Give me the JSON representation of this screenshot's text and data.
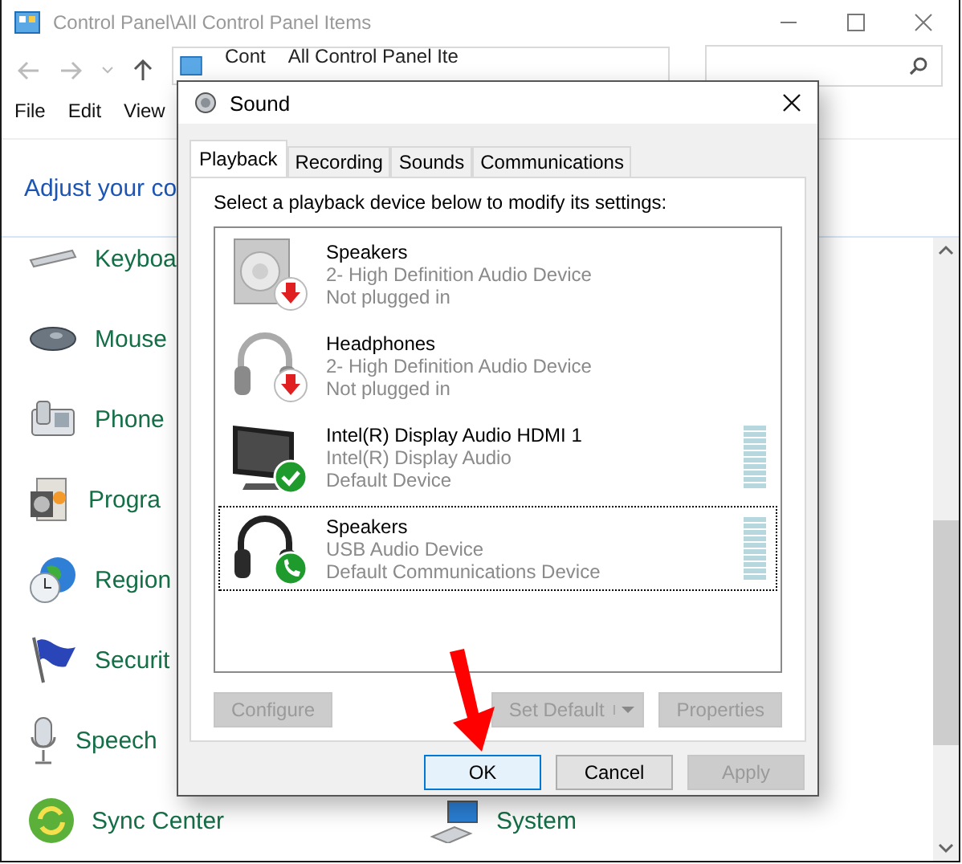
{
  "window": {
    "title": "Control Panel\\All Control Panel Items",
    "address": [
      "Cont",
      "All Control Panel Ite"
    ],
    "menu": [
      "File",
      "Edit",
      "View"
    ],
    "heading": "Adjust your co",
    "items": [
      {
        "kind": "keyboard",
        "label": "Keyboa"
      },
      {
        "kind": "mouse",
        "label": "Mouse"
      },
      {
        "kind": "phone",
        "label": "Phone"
      },
      {
        "kind": "programs",
        "label": "Progra"
      },
      {
        "kind": "region",
        "label": "Region"
      },
      {
        "kind": "security",
        "label": "Securit"
      },
      {
        "kind": "speech",
        "label": "Speech"
      },
      {
        "kind": "sync",
        "label": "Sync Center"
      },
      {
        "kind": "system",
        "label": "System"
      }
    ]
  },
  "dialog": {
    "title": "Sound",
    "tabs": [
      {
        "label": "Playback",
        "selected": true
      },
      {
        "label": "Recording",
        "selected": false
      },
      {
        "label": "Sounds",
        "selected": false
      },
      {
        "label": "Communications",
        "selected": false
      }
    ],
    "instruction": "Select a playback device below to modify its settings:",
    "devices": [
      {
        "kind": "speaker",
        "plugged_in": false,
        "default": false,
        "default_communications": false,
        "name": "Speakers",
        "detail": "2- High Definition Audio Device",
        "state": "Not plugged in",
        "selected": false,
        "meter": false
      },
      {
        "kind": "headphones",
        "plugged_in": false,
        "default": false,
        "default_communications": false,
        "name": "Headphones",
        "detail": "2- High Definition Audio Device",
        "state": "Not plugged in",
        "selected": false,
        "meter": false
      },
      {
        "kind": "monitor",
        "plugged_in": true,
        "default": true,
        "default_communications": false,
        "name": "Intel(R) Display Audio HDMI 1",
        "detail": "Intel(R) Display Audio",
        "state": "Default Device",
        "selected": false,
        "meter": true
      },
      {
        "kind": "headset",
        "plugged_in": true,
        "default": false,
        "default_communications": true,
        "name": "Speakers",
        "detail": "USB Audio Device",
        "state": "Default Communications Device",
        "selected": true,
        "meter": true
      }
    ],
    "panel_buttons": [
      {
        "label": "Configure",
        "disabled": true,
        "dropdown": false
      },
      {
        "label": "Set Default",
        "disabled": true,
        "dropdown": true
      },
      {
        "label": "Properties",
        "disabled": true,
        "dropdown": false
      }
    ],
    "buttons": [
      {
        "label": "OK",
        "disabled": false,
        "default": true
      },
      {
        "label": "Cancel",
        "disabled": false,
        "default": false
      },
      {
        "label": "Apply",
        "disabled": true,
        "default": false
      }
    ]
  }
}
